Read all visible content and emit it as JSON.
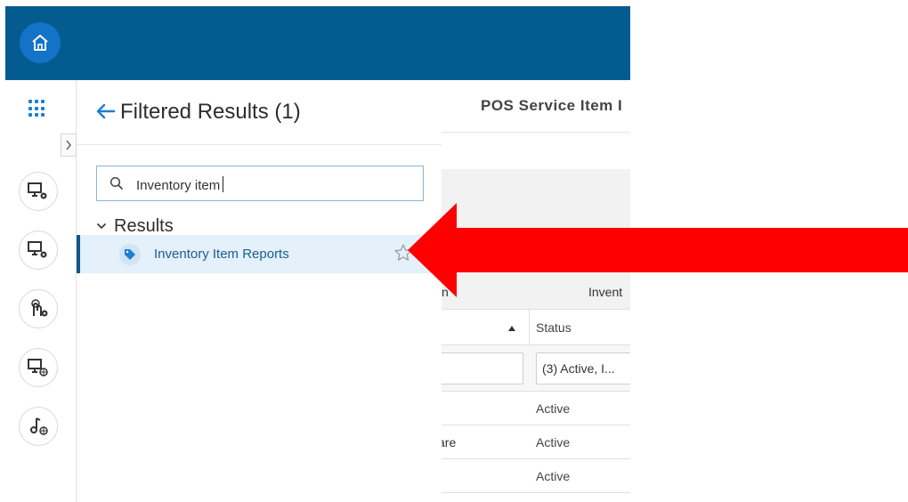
{
  "panel": {
    "title": "Filtered Results (1)",
    "search_value": "Inventory item",
    "results_label": "Results",
    "result_item": "Inventory Item Reports"
  },
  "nav": {
    "icons": [
      "monitor-settings-icon",
      "monitor-settings-icon",
      "touch-settings-icon",
      "monitor-globe-icon",
      "music-globe-icon"
    ]
  },
  "main": {
    "title": "POS Service Item I",
    "group_header_left": "n",
    "group_header_right": "Invent",
    "status_header": "Status",
    "status_filter": "(3) Active, I...",
    "rows": [
      {
        "c1": "",
        "status": "Active"
      },
      {
        "c1": "are",
        "status": "Active"
      },
      {
        "c1": "",
        "status": "Active"
      }
    ]
  },
  "colors": {
    "topbar": "#035b8f",
    "accent": "#1273c7",
    "selected_row": "#e4f0fa",
    "arrow": "#ff0000"
  }
}
